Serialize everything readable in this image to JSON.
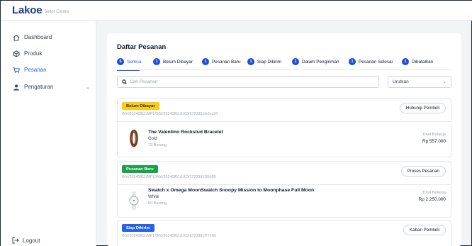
{
  "app": {
    "brand": "Lakoe",
    "brand_sub": "Seller Centre"
  },
  "sidebar": {
    "items": [
      {
        "label": "Dashboard",
        "icon": "home-icon",
        "active": false
      },
      {
        "label": "Produk",
        "icon": "box-icon",
        "active": false
      },
      {
        "label": "Pesanan",
        "icon": "cart-icon",
        "active": true
      },
      {
        "label": "Pengaturan",
        "icon": "user-gear-icon",
        "active": false
      }
    ],
    "logout_label": "Logout"
  },
  "main": {
    "title": "Daftar Pesanan",
    "tabs": [
      {
        "count": "6",
        "label": "Semua"
      },
      {
        "count": "1",
        "label": "Belum Dibayar"
      },
      {
        "count": "1",
        "label": "Pesanan Baru"
      },
      {
        "count": "1",
        "label": "Siap Dikirim"
      },
      {
        "count": "1",
        "label": "Dalam Pengiriman"
      },
      {
        "count": "1",
        "label": "Pesanan Selesai"
      },
      {
        "count": "1",
        "label": "Dibatalkan"
      }
    ],
    "search_placeholder": "Cari Pesanan",
    "sort_label": "Urutkan",
    "orders": [
      {
        "status": "Belum Dibayar",
        "invoice": "INV/20240811/MPL/INV/20240811/LKD/1723391fe5cc34",
        "action": "Hubungi Pembeli",
        "product_name": "The Valentino Rockstud Bracelet",
        "variant": "Gold",
        "qty": "73 Barang",
        "total_label": "Total Belanja",
        "total": "Rp 557.000"
      },
      {
        "status": "Pesanan Baru",
        "invoice": "INV/20240811/MPL/INV/20240811/LKD/1723391f35490",
        "action": "Proses Pesanan",
        "product_name": "Swatch x Omega MoonSwatch Snoopy Mission to Moonphase Full Moon",
        "variant": "White",
        "qty": "50 Barang",
        "total_label": "Total Belanja",
        "total": "Rp 2.250.000"
      },
      {
        "status": "Siap Dikirim",
        "invoice": "INV/20240811/MPL/INV/20240811/LKD/1723391f77169",
        "action": "Kabari Pembeli"
      }
    ]
  },
  "colors": {
    "accent": "#2563eb",
    "badge_unpaid": "#facc15",
    "badge_new": "#16a34a",
    "badge_ready": "#2563eb"
  }
}
